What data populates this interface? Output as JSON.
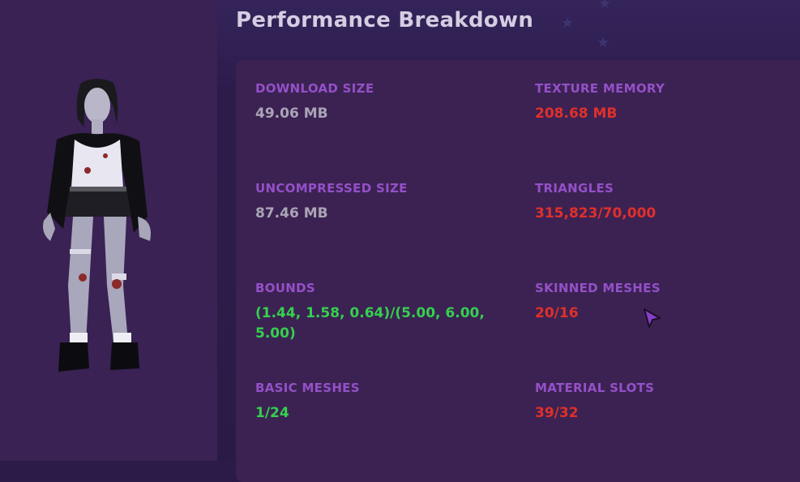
{
  "header": {
    "title": "Performance Breakdown"
  },
  "stats": {
    "download_size": {
      "label": "DOWNLOAD SIZE",
      "value": "49.06 MB",
      "status": "neutral"
    },
    "texture_memory": {
      "label": "TEXTURE MEMORY",
      "value": "208.68 MB",
      "status": "bad"
    },
    "uncompressed_size": {
      "label": "UNCOMPRESSED SIZE",
      "value": "87.46 MB",
      "status": "neutral"
    },
    "triangles": {
      "label": "TRIANGLES",
      "value": "315,823/70,000",
      "status": "bad"
    },
    "bounds": {
      "label": "BOUNDS",
      "value": "(1.44, 1.58, 0.64)/(5.00, 6.00, 5.00)",
      "status": "good"
    },
    "skinned_meshes": {
      "label": "SKINNED MESHES",
      "value": "20/16",
      "status": "bad"
    },
    "basic_meshes": {
      "label": "BASIC MESHES",
      "value": "1/24",
      "status": "good"
    },
    "material_slots": {
      "label": "MATERIAL SLOTS",
      "value": "39/32",
      "status": "bad"
    }
  },
  "colors": {
    "label": "#9450c8",
    "neutral": "#aaa5b6",
    "bad": "#e0302a",
    "good": "#35d04e",
    "panel": "#3c2253",
    "background": "#2c1a48"
  },
  "icons": {
    "cursor": "pointer-arrow-icon",
    "avatar": "avatar-preview"
  }
}
